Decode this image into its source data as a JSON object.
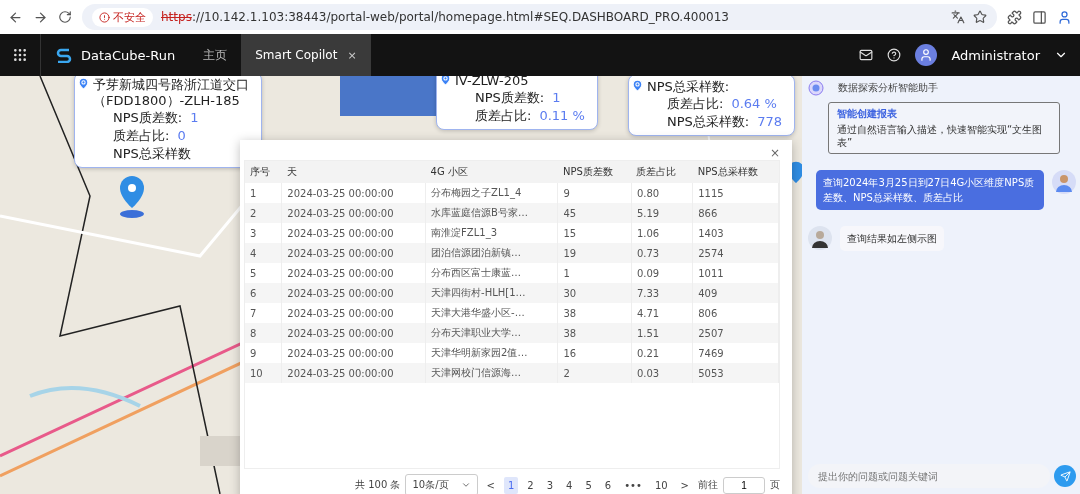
{
  "browser": {
    "security_label": "不安全",
    "url_scheme": "https",
    "url_rest": "://10.142.1.103:38443/portal-web/portal/homepage.html#SEQ.DASHBOARD_PRO.400013"
  },
  "app_bar": {
    "brand": "DataCube-Run",
    "tabs": [
      {
        "label": "主页",
        "selected": false
      },
      {
        "label": "Smart Copilot",
        "selected": true,
        "close": "×"
      }
    ],
    "user": "Administrator"
  },
  "map_popups": [
    {
      "title_lines": [
        "予芽新城四号路浙江道交口",
        "（FDD1800）-ZLH-185"
      ],
      "rows": [
        {
          "label": "NPS质差数:",
          "value": "1"
        },
        {
          "label": "质差占比:",
          "value": "0"
        },
        {
          "label": "NPS总采样数",
          "value": ""
        }
      ]
    },
    {
      "title_lines": [
        "IV-ZLW-205"
      ],
      "rows": [
        {
          "label": "NPS质差数:",
          "value": "1"
        },
        {
          "label": "质差占比:",
          "value": "0.11 %"
        }
      ]
    },
    {
      "title_lines": [
        "NPS总采样数:"
      ],
      "rows": [
        {
          "label": "质差占比:",
          "value": "0.64 %"
        },
        {
          "label": "NPS总采样数:",
          "value": "778"
        }
      ]
    }
  ],
  "modal": {
    "close": "×",
    "columns": [
      "序号",
      "天",
      "4G 小区",
      "NPS质差数",
      "质差占比",
      "NPS总采样数"
    ],
    "rows": [
      [
        "1",
        "2024-03-25 00:00:00",
        "分布梅园之子ZL1_4",
        "9",
        "0.80",
        "1115"
      ],
      [
        "2",
        "2024-03-25 00:00:00",
        "水库蓝庭信源B号家…",
        "45",
        "5.19",
        "866"
      ],
      [
        "3",
        "2024-03-25 00:00:00",
        "南淮淀FZL1_3",
        "15",
        "1.06",
        "1403"
      ],
      [
        "4",
        "2024-03-25 00:00:00",
        "团泊信源团泊新镇…",
        "19",
        "0.73",
        "2574"
      ],
      [
        "5",
        "2024-03-25 00:00:00",
        "分布西区富士康蓝…",
        "1",
        "0.09",
        "1011"
      ],
      [
        "6",
        "2024-03-25 00:00:00",
        "天津四街村-HLH[1…",
        "30",
        "7.33",
        "409"
      ],
      [
        "7",
        "2024-03-25 00:00:00",
        "天津大港华盛小区-…",
        "38",
        "4.71",
        "806"
      ],
      [
        "8",
        "2024-03-25 00:00:00",
        "分布天津职业大学…",
        "38",
        "1.51",
        "2507"
      ],
      [
        "9",
        "2024-03-25 00:00:00",
        "天津华明新家园2值…",
        "16",
        "0.21",
        "7469"
      ],
      [
        "10",
        "2024-03-25 00:00:00",
        "天津网校门信源海…",
        "2",
        "0.03",
        "5053"
      ]
    ],
    "pagination": {
      "total": "共 100 条",
      "page_size": "10条/页",
      "prev": "<",
      "next": ">",
      "pages": [
        {
          "label": "1",
          "selected": true
        },
        {
          "label": "2",
          "selected": false
        },
        {
          "label": "3",
          "selected": false
        },
        {
          "label": "4",
          "selected": false
        },
        {
          "label": "5",
          "selected": false
        },
        {
          "label": "6",
          "selected": false
        },
        {
          "label": "•••",
          "selected": false
        },
        {
          "label": "10",
          "selected": false
        }
      ],
      "goto_label": "前往",
      "goto_value": "1",
      "goto_suffix": "页"
    }
  },
  "chat": {
    "assistant_name": "数据探索分析智能助手",
    "card": {
      "title": "智能创建报表",
      "description": "通过自然语言输入描述，快速智能实现“文生图表”"
    },
    "messages": [
      {
        "kind": "user",
        "text": "查询2024年3月25日到27日4G小区维度NPS质差数、NPS总采样数、质差占比"
      },
      {
        "kind": "bot",
        "text": "查询结果如左侧示图"
      }
    ],
    "input_placeholder": "提出你的问题或问题关键词"
  }
}
